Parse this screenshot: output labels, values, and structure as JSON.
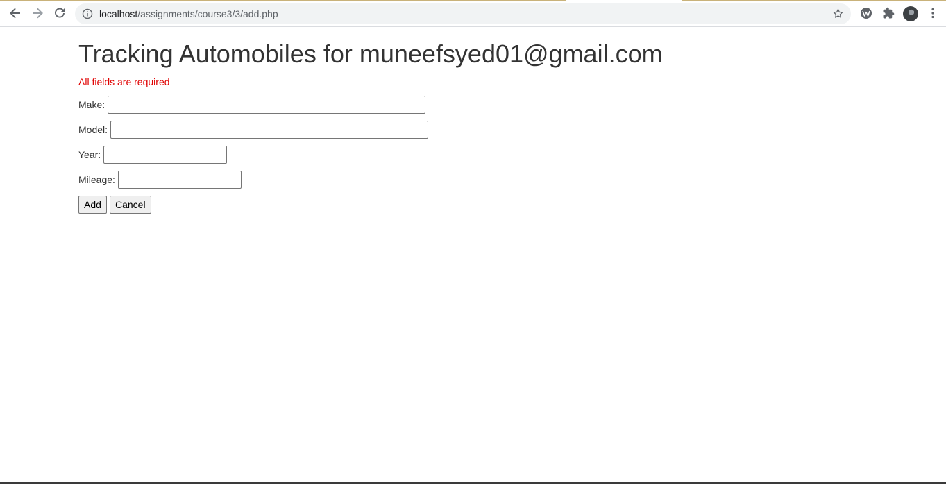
{
  "browser": {
    "url_host": "localhost",
    "url_path": "/assignments/course3/3/add.php",
    "accent_color": "#c9b27a"
  },
  "page": {
    "title": "Tracking Automobiles for muneefsyed01@gmail.com",
    "error_message": "All fields are required",
    "error_color": "#e00000"
  },
  "form": {
    "make_label": "Make:",
    "make_value": "",
    "model_label": "Model:",
    "model_value": "",
    "year_label": "Year:",
    "year_value": "",
    "mileage_label": "Mileage:",
    "mileage_value": "",
    "add_label": "Add",
    "cancel_label": "Cancel"
  }
}
